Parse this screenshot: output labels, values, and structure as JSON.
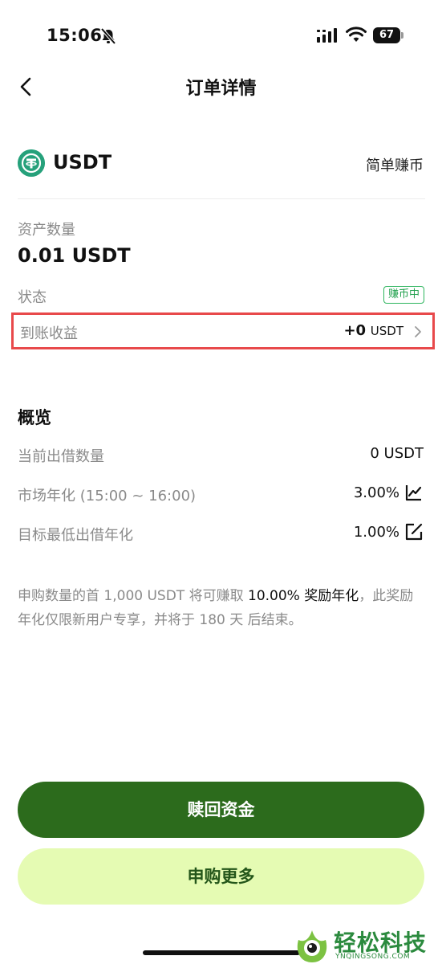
{
  "status_bar": {
    "time": "15:06",
    "battery": "67"
  },
  "nav": {
    "title": "订单详情"
  },
  "asset": {
    "name": "USDT",
    "product": "简单赚币"
  },
  "details": {
    "amount_label": "资产数量",
    "amount_value": "0.01 USDT",
    "status_label": "状态",
    "status_badge": "赚币中",
    "earnings_label": "到账收益",
    "earnings_value": "+0",
    "earnings_unit": "USDT"
  },
  "overview": {
    "title": "概览",
    "rows": [
      {
        "label": "当前出借数量",
        "value": "0 USDT"
      },
      {
        "label": "市场年化 (15:00 ~ 16:00)",
        "value": "3.00%",
        "icon": "trend-chart-icon"
      },
      {
        "label": "目标最低出借年化",
        "value": "1.00%",
        "icon": "edit-icon"
      }
    ]
  },
  "promo": {
    "part1": "申购数量的首 1,000 USDT 将可赚取 ",
    "highlight": "10.00% 奖励年化",
    "part2": "，此奖励年化仅限新用户专享，并将于 180 天 后结束。"
  },
  "buttons": {
    "redeem": "赎回资金",
    "subscribe": "申购更多"
  },
  "watermark": {
    "text": "轻松科技",
    "sub": "YNQINGSONG.COM"
  },
  "colors": {
    "primary_button": "#2c6b1c",
    "secondary_button": "#e5fbb3",
    "status_green": "#23a14f",
    "highlight_border": "#e8494b",
    "usdt_logo": "#26A17B"
  }
}
